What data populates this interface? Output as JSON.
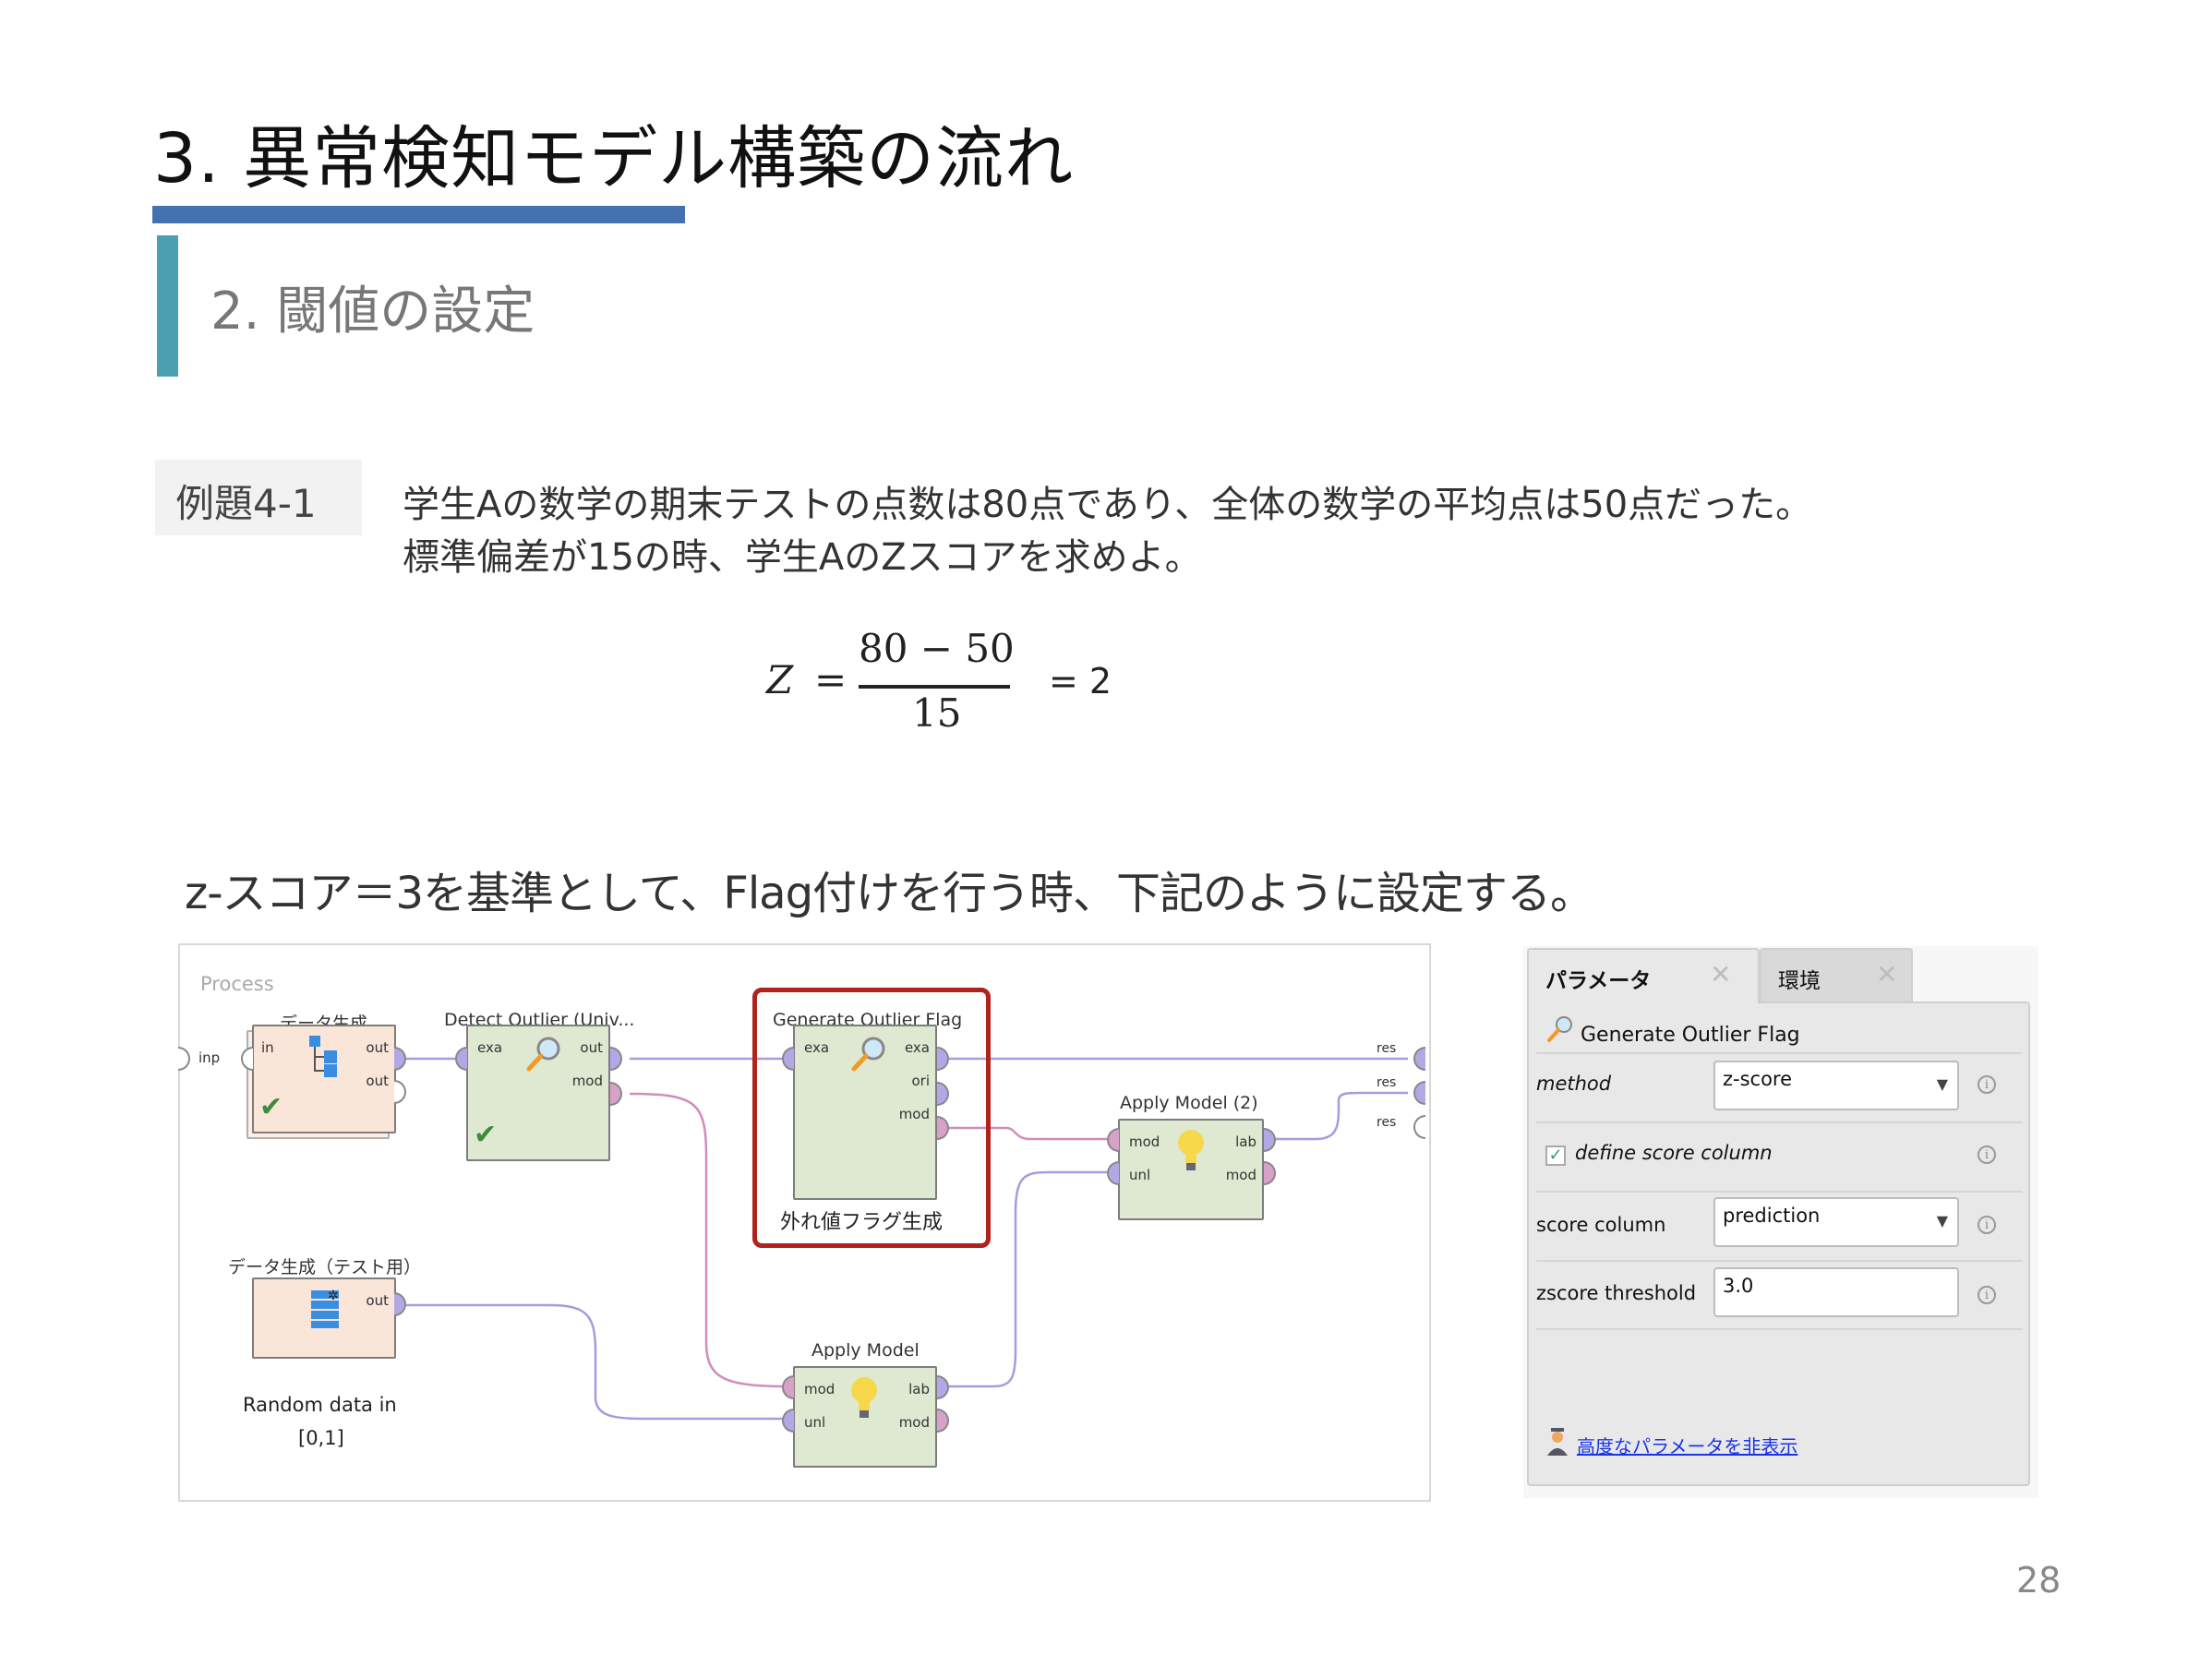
{
  "slide": {
    "title": "3. 異常検知モデル構築の流れ",
    "subtitle": "2. 閾値の設定",
    "example_label": "例題4-1",
    "question_lines": [
      "学生Aの数学の期末テストの点数は80点であり、全体の数学の平均点は50点だった。",
      "標準偏差が15の時、学生AのZスコアを求めよ。"
    ],
    "formula": {
      "lhs": "Z",
      "equals": "=",
      "numerator": "80 − 50",
      "denominator": "15",
      "result": "= 2"
    },
    "instruction": "z-スコア＝3を基準として、Flag付けを行う時、下記のように設定する。",
    "page_number": "28"
  },
  "process": {
    "label": "Process",
    "input_port": "inp",
    "operators": [
      {
        "name": "データ生成",
        "ports_in": [
          "in"
        ],
        "ports_out": [
          "out",
          "out"
        ],
        "icon": "hierarchy-icon",
        "status": "check"
      },
      {
        "name": "Detect Outlier (Univ...",
        "ports_in": [
          "exa"
        ],
        "ports_out": [
          "out",
          "mod"
        ],
        "icon": "magnifier-icon",
        "status": "check"
      },
      {
        "name": "Generate Outlier Flag",
        "ports_in": [
          "exa"
        ],
        "ports_out": [
          "exa",
          "ori",
          "mod"
        ],
        "icon": "magnifier-icon",
        "caption": "外れ値フラグ生成"
      },
      {
        "name": "Apply Model (2)",
        "ports_in": [
          "mod",
          "unl"
        ],
        "ports_out": [
          "lab",
          "mod"
        ],
        "icon": "lightbulb-icon"
      },
      {
        "name": "データ生成（テスト用）",
        "ports_in": [],
        "ports_out": [
          "out"
        ],
        "icon": "data-generate-icon",
        "caption_lines": [
          "Random data in",
          "[0,1]"
        ]
      },
      {
        "name": "Apply Model",
        "ports_in": [
          "mod",
          "unl"
        ],
        "ports_out": [
          "lab",
          "mod"
        ],
        "icon": "lightbulb-icon"
      }
    ],
    "result_ports": [
      "res",
      "res",
      "res"
    ]
  },
  "parameters": {
    "tabs": [
      {
        "label": "パラメータ",
        "active": true
      },
      {
        "label": "環境",
        "active": false
      }
    ],
    "operator_title": "Generate Outlier Flag",
    "rows": [
      {
        "label": "method",
        "type": "select",
        "value": "z-score"
      },
      {
        "label": "define score column",
        "type": "checkbox",
        "checked": true
      },
      {
        "label": "score column",
        "type": "select",
        "value": "prediction"
      },
      {
        "label": "zscore threshold",
        "type": "text",
        "value": "3.0"
      }
    ],
    "advanced_link": "高度なパラメータを非表示"
  },
  "colors": {
    "title_bar": "#4472b0",
    "subtitle_bar": "#4aa0b0",
    "highlight_box": "#b0221b",
    "link": "#1a33e6"
  }
}
